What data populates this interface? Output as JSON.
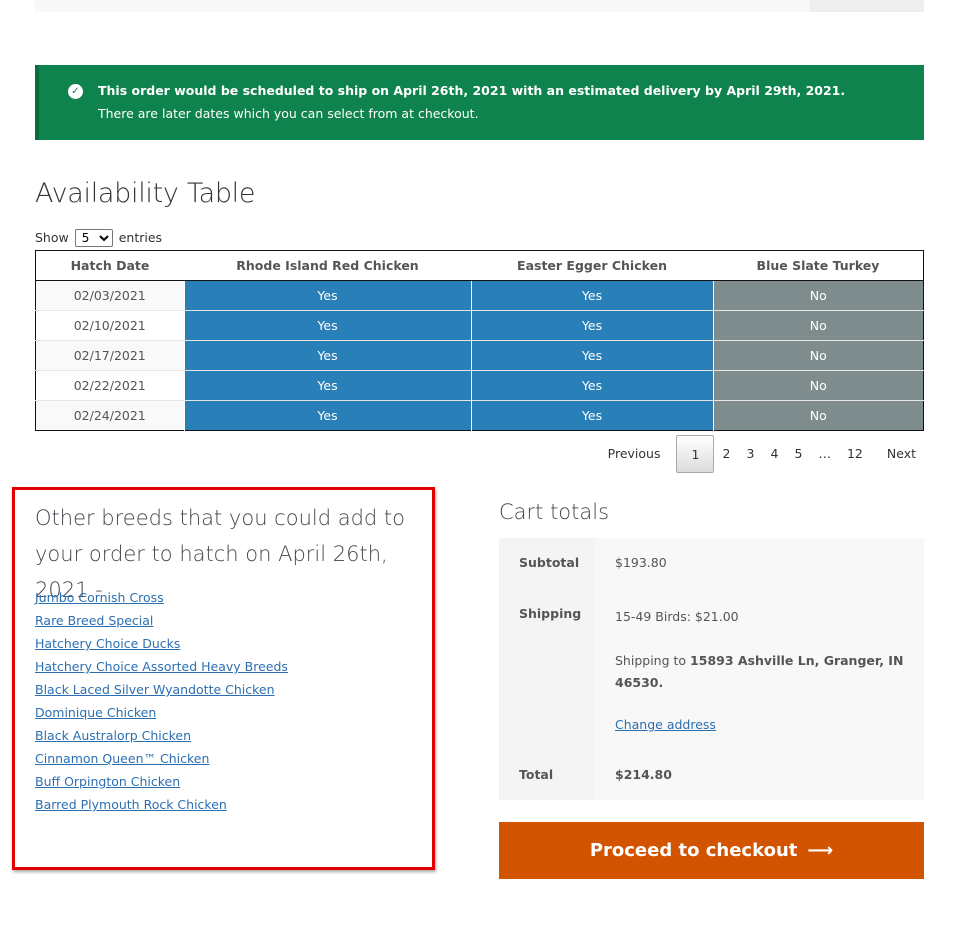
{
  "notice": {
    "line1": "This order would be scheduled to ship on April 26th, 2021 with an estimated delivery by April 29th, 2021.",
    "line2": "There are later dates which you can select from at checkout."
  },
  "availability": {
    "title": "Availability Table",
    "show_label": "Show",
    "entries_label": "entries",
    "page_size": "5",
    "headers": [
      "Hatch Date",
      "Rhode Island Red Chicken",
      "Easter Egger Chicken",
      "Blue Slate Turkey"
    ],
    "rows": [
      [
        "02/03/2021",
        "Yes",
        "Yes",
        "No"
      ],
      [
        "02/10/2021",
        "Yes",
        "Yes",
        "No"
      ],
      [
        "02/17/2021",
        "Yes",
        "Yes",
        "No"
      ],
      [
        "02/22/2021",
        "Yes",
        "Yes",
        "No"
      ],
      [
        "02/24/2021",
        "Yes",
        "Yes",
        "No"
      ]
    ],
    "yes_color": "#2980b9",
    "no_color": "#7f8c8d"
  },
  "pagination": {
    "previous": "Previous",
    "pages": [
      "1",
      "2",
      "3",
      "4",
      "5",
      "…",
      "12"
    ],
    "active": "1",
    "next": "Next"
  },
  "other_breeds": {
    "heading": "Other breeds that you could add to your order to hatch on April 26th, 2021 -",
    "links": [
      "Jumbo Cornish Cross",
      "Rare Breed Special",
      "Hatchery Choice Ducks",
      "Hatchery Choice Assorted Heavy Breeds",
      "Black Laced Silver Wyandotte Chicken",
      "Dominique Chicken",
      "Black Australorp Chicken",
      "Cinnamon Queen™ Chicken",
      "Buff Orpington Chicken",
      "Barred Plymouth Rock Chicken"
    ]
  },
  "cart": {
    "title": "Cart totals",
    "subtotal_label": "Subtotal",
    "subtotal_value": "$193.80",
    "shipping_label": "Shipping",
    "shipping_value": "15-49 Birds: $21.00",
    "shipping_to_prefix": "Shipping to",
    "shipping_address": "15893 Ashville Ln, Granger, IN 46530.",
    "change_address": "Change address",
    "total_label": "Total",
    "total_value": "$214.80"
  },
  "checkout": {
    "label": "Proceed to checkout",
    "arrow_icon": "arrow-right-icon",
    "color": "#d35400"
  },
  "colors": {
    "notice_bg": "#0f834d",
    "highlight_border": "#e00000"
  }
}
